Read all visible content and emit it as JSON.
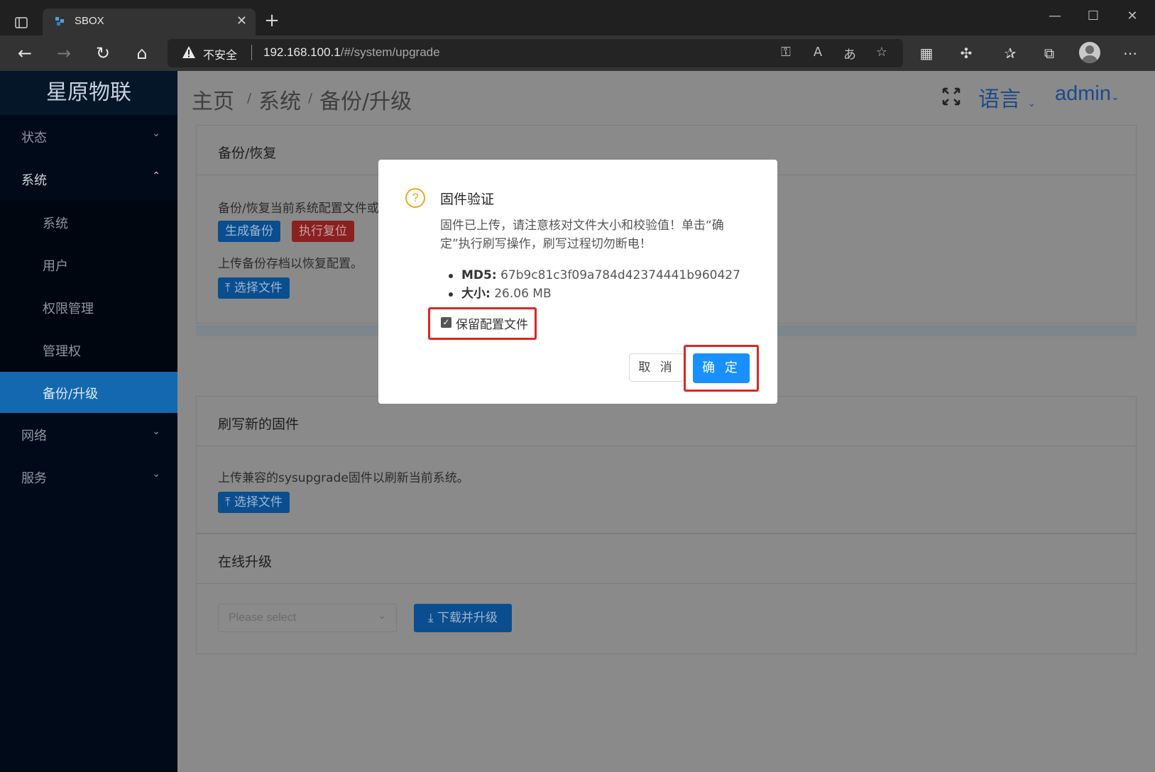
{
  "browser": {
    "tab_title": "SBOX",
    "tab_close": "✕",
    "new_tab": "+",
    "insecure_label": "不安全",
    "url_host": "192.168.100.1",
    "url_path": "/#/system/upgrade"
  },
  "app": {
    "logo": "星原物联",
    "menu": {
      "status": "状态",
      "system": "系统",
      "network": "网络",
      "services": "服务"
    },
    "submenu": {
      "system": "系统",
      "users": "用户",
      "permissions": "权限管理",
      "admin_rights": "管理权",
      "backup_upgrade": "备份/升级"
    },
    "breadcrumb": {
      "home": "主页",
      "system": "系统",
      "current": "备份/升级",
      "sep": "/"
    },
    "language": "语言",
    "user": "admin"
  },
  "backup": {
    "title": "备份/恢复",
    "desc": "备份/恢复当前系统配置文件或",
    "generate_btn": "生成备份",
    "reset_btn": "执行复位",
    "upload_desc": "上传备份存档以恢复配置。",
    "choose_file": "选择文件"
  },
  "flash": {
    "title": "刷写新的固件",
    "desc": "上传兼容的sysupgrade固件以刷新当前系统。",
    "choose_file": "选择文件"
  },
  "online": {
    "title": "在线升级",
    "select_placeholder": "Please select",
    "download_btn": "下载并升级"
  },
  "modal": {
    "title": "固件验证",
    "body": "固件已上传，请注意核对文件大小和校验值！单击“确定”执行刷写操作，刷写过程切勿断电！",
    "md5_label": "MD5:",
    "md5_value": "67b9c81c3f09a784d42374441b960427",
    "size_label": "大小:",
    "size_value": "26.06 MB",
    "keep_config_label": "保留配置文件",
    "keep_config_checked": true,
    "cancel_btn": "取 消",
    "ok_btn": "确 定"
  },
  "colors": {
    "primary": "#1890ff",
    "warning": "#f0a71c",
    "highlight": "#e02424",
    "sidebar_active": "#1468b0"
  }
}
